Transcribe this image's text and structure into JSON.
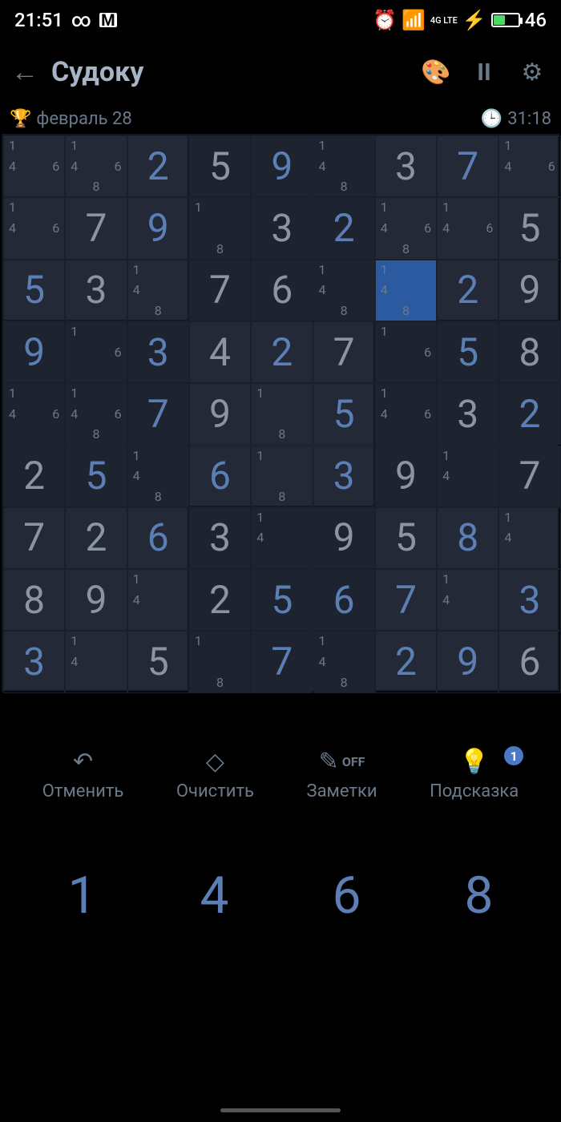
{
  "status": {
    "time": "21:51",
    "battery": "46",
    "net": "4G LTE"
  },
  "appbar": {
    "title": "Судоку"
  },
  "meta": {
    "date": "февраль 28",
    "timer": "31:18"
  },
  "tools": {
    "undo": "Отменить",
    "erase": "Очистить",
    "notes": "Заметки",
    "notes_state": "OFF",
    "hint": "Подсказка",
    "hint_badge": "1"
  },
  "numpad": [
    "1",
    "4",
    "6",
    "8"
  ],
  "board": {
    "selected": [
      2,
      6
    ],
    "cells": [
      [
        {
          "c": [
            1,
            4,
            6
          ]
        },
        {
          "c": [
            1,
            4,
            6,
            8
          ]
        },
        {
          "v": "2",
          "t": "u"
        },
        {
          "v": "5",
          "t": "g"
        },
        {
          "v": "9",
          "t": "u"
        },
        {
          "c": [
            1,
            4,
            8
          ]
        },
        {
          "v": "3",
          "t": "g"
        },
        {
          "v": "7",
          "t": "u"
        },
        {
          "c": [
            1,
            4,
            6
          ]
        }
      ],
      [
        {
          "c": [
            1,
            4,
            6
          ]
        },
        {
          "v": "7",
          "t": "g"
        },
        {
          "v": "9",
          "t": "u"
        },
        {
          "c": [
            1,
            8
          ]
        },
        {
          "v": "3",
          "t": "g"
        },
        {
          "v": "2",
          "t": "u"
        },
        {
          "c": [
            1,
            4,
            6,
            8
          ]
        },
        {
          "c": [
            1,
            4,
            6
          ]
        },
        {
          "v": "5",
          "t": "g"
        }
      ],
      [
        {
          "v": "5",
          "t": "u"
        },
        {
          "v": "3",
          "t": "g"
        },
        {
          "c": [
            1,
            4,
            8
          ]
        },
        {
          "v": "7",
          "t": "g"
        },
        {
          "v": "6",
          "t": "g"
        },
        {
          "c": [
            1,
            4,
            8
          ]
        },
        {
          "c": [
            1,
            4,
            8
          ]
        },
        {
          "v": "2",
          "t": "u"
        },
        {
          "v": "9",
          "t": "g"
        }
      ],
      [
        {
          "v": "9",
          "t": "u"
        },
        {
          "c": [
            1,
            6
          ]
        },
        {
          "v": "3",
          "t": "u"
        },
        {
          "v": "4",
          "t": "g"
        },
        {
          "v": "2",
          "t": "u"
        },
        {
          "v": "7",
          "t": "g"
        },
        {
          "c": [
            1,
            6
          ]
        },
        {
          "v": "5",
          "t": "u"
        },
        {
          "v": "8",
          "t": "g"
        }
      ],
      [
        {
          "c": [
            1,
            4,
            6
          ]
        },
        {
          "c": [
            1,
            4,
            6,
            8
          ]
        },
        {
          "v": "7",
          "t": "u"
        },
        {
          "v": "9",
          "t": "g"
        },
        {
          "c": [
            1,
            8
          ]
        },
        {
          "v": "5",
          "t": "u"
        },
        {
          "c": [
            1,
            4,
            6
          ]
        },
        {
          "v": "3",
          "t": "g"
        },
        {
          "v": "2",
          "t": "u"
        }
      ],
      [
        {
          "v": "2",
          "t": "g"
        },
        {
          "v": "5",
          "t": "u"
        },
        {
          "c": [
            1,
            4,
            8
          ]
        },
        {
          "v": "6",
          "t": "u"
        },
        {
          "c": [
            1,
            8
          ]
        },
        {
          "v": "3",
          "t": "u"
        },
        {
          "v": "9",
          "t": "g"
        },
        {
          "c": [
            1,
            4
          ]
        },
        {
          "v": "7",
          "t": "g"
        }
      ],
      [
        {
          "v": "7",
          "t": "g"
        },
        {
          "v": "2",
          "t": "g"
        },
        {
          "v": "6",
          "t": "u"
        },
        {
          "v": "3",
          "t": "g"
        },
        {
          "c": [
            1,
            4
          ]
        },
        {
          "v": "9",
          "t": "g"
        },
        {
          "v": "5",
          "t": "g"
        },
        {
          "v": "8",
          "t": "u"
        },
        {
          "c": [
            1,
            4
          ]
        }
      ],
      [
        {
          "v": "8",
          "t": "g"
        },
        {
          "v": "9",
          "t": "g"
        },
        {
          "c": [
            1,
            4
          ]
        },
        {
          "v": "2",
          "t": "g"
        },
        {
          "v": "5",
          "t": "u"
        },
        {
          "v": "6",
          "t": "u"
        },
        {
          "v": "7",
          "t": "u"
        },
        {
          "c": [
            1,
            4
          ]
        },
        {
          "v": "3",
          "t": "u"
        }
      ],
      [
        {
          "v": "3",
          "t": "u"
        },
        {
          "c": [
            1,
            4
          ]
        },
        {
          "v": "5",
          "t": "g"
        },
        {
          "c": [
            1,
            8
          ]
        },
        {
          "v": "7",
          "t": "u"
        },
        {
          "c": [
            1,
            4,
            8
          ]
        },
        {
          "v": "2",
          "t": "u"
        },
        {
          "v": "9",
          "t": "u"
        },
        {
          "v": "6",
          "t": "g"
        }
      ]
    ]
  }
}
